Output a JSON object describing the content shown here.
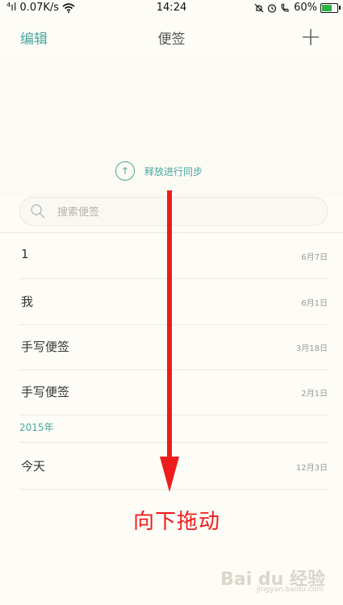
{
  "status": {
    "signal": "⁴ıl",
    "speed": "0.07K/s",
    "time": "14:24",
    "battery": "60%",
    "battery_level": 0.6,
    "icons": [
      "mute-icon",
      "alarm-icon",
      "call-icon",
      "battery-icon"
    ]
  },
  "nav": {
    "edit_label": "编辑",
    "title": "便签"
  },
  "sync": {
    "label": "释放进行同步",
    "icon": "↑"
  },
  "search": {
    "placeholder": "搜索便签"
  },
  "notes": [
    {
      "title": "1",
      "date": "6月7日"
    },
    {
      "title": "我",
      "date": "6月1日"
    },
    {
      "title": "手写便签",
      "date": "3月18日"
    },
    {
      "title": "手写便签",
      "date": "2月1日"
    }
  ],
  "year_header": "2015年",
  "notes_2015": [
    {
      "title": "今天",
      "date": "12月3日"
    }
  ],
  "annotation": {
    "text": "向下拖动",
    "color": "#ee1c1c"
  },
  "watermark": {
    "text": "Bai du 经验",
    "sub": "jingyan.baidu.com"
  },
  "accent_color": "#4aa8a0"
}
